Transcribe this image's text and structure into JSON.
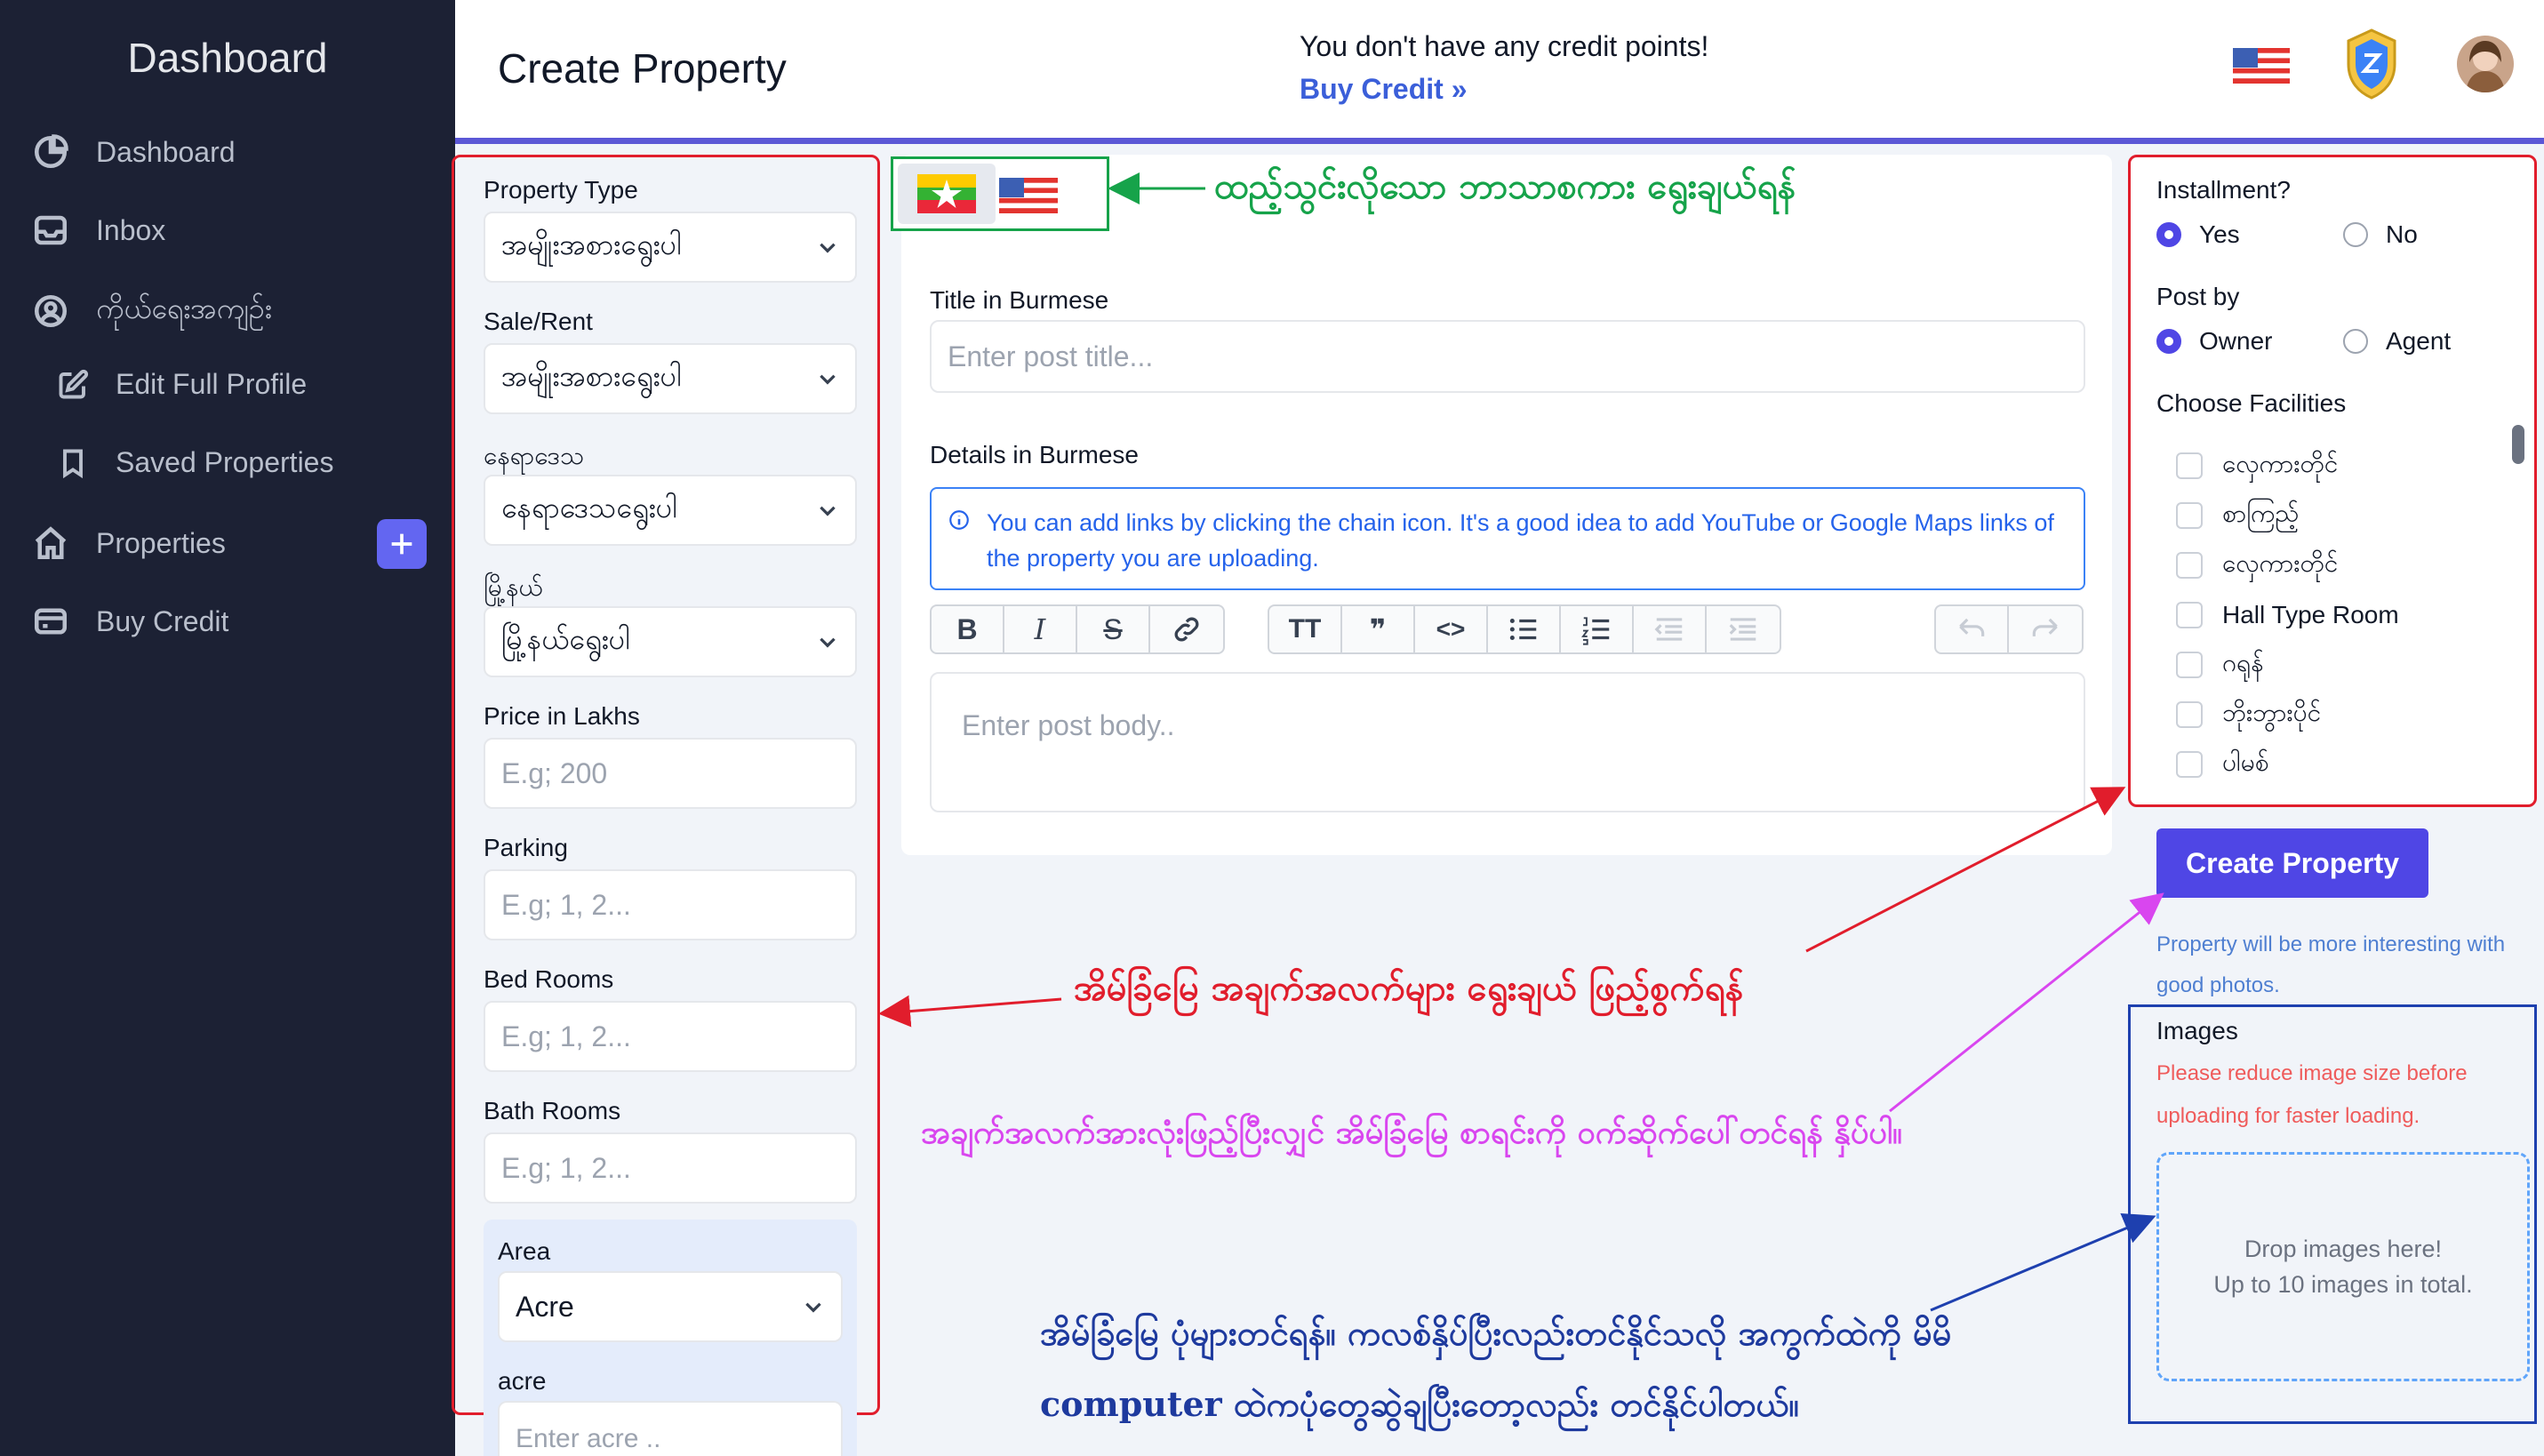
{
  "sidebar": {
    "title": "Dashboard",
    "items": [
      {
        "label": "Dashboard",
        "icon": "pie-chart-icon"
      },
      {
        "label": "Inbox",
        "icon": "inbox-icon"
      },
      {
        "label": "ကိုယ်ရေးအကျဉ်း",
        "icon": "user-circle-icon"
      },
      {
        "label": "Edit Full Profile",
        "icon": "edit-icon"
      },
      {
        "label": "Saved Properties",
        "icon": "bookmark-icon"
      },
      {
        "label": "Properties",
        "icon": "home-icon"
      },
      {
        "label": "Buy Credit",
        "icon": "credit-card-icon"
      }
    ]
  },
  "header": {
    "title": "Create Property",
    "credit_message": "You don't have any credit points!",
    "buy_credit_link": "Buy Credit »"
  },
  "left_form": {
    "property_type": {
      "label": "Property Type",
      "value": "အမျိုးအစားရွေးပါ"
    },
    "sale_rent": {
      "label": "Sale/Rent",
      "value": "အမျိုးအစားရွေးပါ"
    },
    "region": {
      "label": "နေရာဒေသ",
      "value": "နေရာဒေသရွေးပါ"
    },
    "township": {
      "label": "မြို့နယ်",
      "value": "မြို့နယ်ရွေးပါ"
    },
    "price": {
      "label": "Price in Lakhs",
      "placeholder": "E.g; 200"
    },
    "parking": {
      "label": "Parking",
      "placeholder": "E.g; 1, 2..."
    },
    "bed_rooms": {
      "label": "Bed Rooms",
      "placeholder": "E.g; 1, 2..."
    },
    "bath_rooms": {
      "label": "Bath Rooms",
      "placeholder": "E.g; 1, 2..."
    },
    "area": {
      "label": "Area",
      "value": "Acre"
    },
    "acre": {
      "label": "acre",
      "placeholder": "Enter acre .."
    }
  },
  "center": {
    "title_label": "Title in Burmese",
    "title_placeholder": "Enter post title...",
    "details_label": "Details in Burmese",
    "info_text": "You can add links by clicking the chain icon. It's a good idea to add YouTube or Google Maps links of the property you are uploading.",
    "body_placeholder": "Enter post body..",
    "toolbar": {
      "bold": "B",
      "italic": "I",
      "strike": "S",
      "heading": "TT",
      "quote": "❞",
      "code": "<>"
    }
  },
  "right_panel": {
    "installment_label": "Installment?",
    "installment_yes": "Yes",
    "installment_no": "No",
    "post_by_label": "Post by",
    "post_by_owner": "Owner",
    "post_by_agent": "Agent",
    "facilities_label": "Choose Facilities",
    "facilities": [
      "လှေကားတိုင်",
      "စာကြည့်",
      "လှေကားတိုင်",
      "Hall Type Room",
      "ဂရုန်",
      "ဘိုးဘွားပိုင်",
      "ပါမစ်"
    ],
    "create_button": "Create Property",
    "photo_note": "Property will be more interesting with good photos.",
    "images_label": "Images",
    "image_size_note": "Please reduce image size before uploading for faster loading.",
    "drop_line1": "Drop images here!",
    "drop_line2": "Up to 10 images in total."
  },
  "annotations": {
    "language_select": "ထည့်သွင်းလိုသော ဘာသာစကား ရွေးချယ်ရန်",
    "property_info": "အိမ်ခြံမြေ အချက်အလက်များ ရွေးချယ် ဖြည့်စွက်ရန်",
    "submit_hint": "အချက်အလက်အားလုံးဖြည့်ပြီးလျှင် အိမ်ခြံမြေ စာရင်းကို ဝက်ဆိုက်ပေါ်တင်ရန် နှိပ်ပါ။",
    "images_line1": "အိမ်ခြံမြေ ပုံများတင်ရန်။ ကလစ်နှိပ်ပြီးလည်းတင်နိုင်သလို အကွက်ထဲကို မိမိ",
    "images_line2": "computer ထဲကပုံတွေဆွဲချပြီးတော့လည်း တင်နိုင်ပါတယ်။"
  },
  "colors": {
    "sidebar_bg": "#1c2134",
    "accent": "#4f46e5",
    "annotation_red": "#e11d2c",
    "annotation_green": "#16a34a",
    "annotation_magenta": "#d946ef",
    "annotation_blue": "#1e3a9e"
  }
}
